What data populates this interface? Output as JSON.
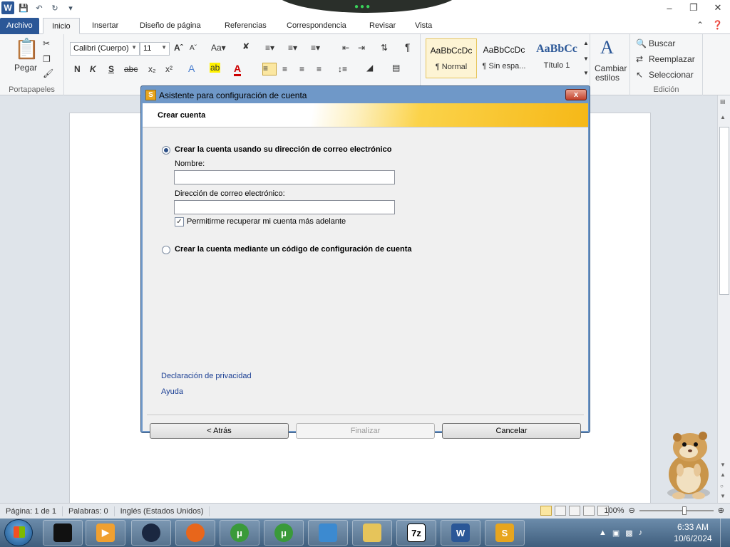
{
  "titlebar": {
    "app_icon": "word-icon",
    "qat_icons": [
      "save-icon",
      "undo-icon",
      "redo-icon",
      "customize-icon"
    ],
    "controls": [
      "minimize-icon",
      "restore-icon",
      "close-icon"
    ]
  },
  "tabs": [
    {
      "label": "Archivo"
    },
    {
      "label": "Inicio"
    },
    {
      "label": "Insertar"
    },
    {
      "label": "Diseño de página"
    },
    {
      "label": "Referencias"
    },
    {
      "label": "Correspondencia"
    },
    {
      "label": "Revisar"
    },
    {
      "label": "Vista"
    }
  ],
  "ribbon": {
    "clipboard": {
      "paste_label": "Pegar",
      "group_label": "Portapapeles"
    },
    "font": {
      "name": "Calibri (Cuerpo)",
      "size": "11"
    },
    "styles": [
      {
        "sample": "AaBbCcDc",
        "name": "¶ Normal"
      },
      {
        "sample": "AaBbCcDc",
        "name": "¶ Sin espa..."
      },
      {
        "sample": "AaBbCc",
        "name": "Título 1"
      }
    ],
    "change_styles": {
      "line1": "Cambiar",
      "line2": "estilos"
    },
    "editing": {
      "find": "Buscar",
      "replace": "Reemplazar",
      "select": "Seleccionar",
      "group_label": "Edición"
    }
  },
  "dialog": {
    "title": "Asistente para configuración de cuenta",
    "close_symbol": "x",
    "header": "Crear cuenta",
    "option_email": "Crear la cuenta usando su dirección de correo electrónico",
    "name_label": "Nombre:",
    "name_value": "",
    "email_label": "Dirección de correo electrónico:",
    "email_value": "",
    "recover_label": "Permitirme recuperar mi cuenta más adelante",
    "recover_checked": true,
    "option_code": "Crear la cuenta mediante un código de configuración de cuenta",
    "privacy_link": "Declaración de privacidad",
    "help_link": "Ayuda",
    "back_button": "< Atrás",
    "finish_button": "Finalizar",
    "cancel_button": "Cancelar"
  },
  "statusbar": {
    "page": "Página: 1 de 1",
    "words": "Palabras: 0",
    "language": "Inglés (Estados Unidos)",
    "zoom": "100%"
  },
  "taskbar": {
    "clock_time": "6:33 AM",
    "clock_date": "10/6/2024"
  }
}
